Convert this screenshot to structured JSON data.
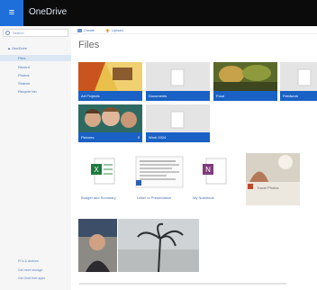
{
  "app": {
    "title": "OneDrive",
    "waffle_glyph": "≡"
  },
  "colors": {
    "accent": "#1961c4",
    "topbar": "#0b0b0b",
    "waffle": "#1e6fd9",
    "sidebar": "#f6f6f6"
  },
  "search": {
    "placeholder": "Search"
  },
  "sidebar": {
    "items": [
      {
        "label": "▲ OneDrive"
      },
      {
        "label": "Files"
      },
      {
        "label": "Recent"
      },
      {
        "label": "Photos"
      },
      {
        "label": "Shared"
      },
      {
        "label": "Recycle bin"
      }
    ],
    "footer": [
      {
        "label": "PCs & devices"
      },
      {
        "label": "Get more storage"
      },
      {
        "label": "Get OneDrive apps"
      }
    ]
  },
  "commands": [
    {
      "label": "Create",
      "icon": "plus-icon"
    },
    {
      "label": "Upload",
      "icon": "upload-icon"
    }
  ],
  "page_title": "Files",
  "folders": [
    {
      "name": "Art Projects",
      "count": ""
    },
    {
      "name": "Documents",
      "count": ""
    },
    {
      "name": "Food",
      "count": ""
    },
    {
      "name": "Fieldwork",
      "count": ""
    },
    {
      "name": "Pictures",
      "count": "9"
    },
    {
      "name": "Work 2024",
      "count": ""
    }
  ],
  "files": [
    {
      "name": "Budget and Summary",
      "type": "excel"
    },
    {
      "name": "Letter to Presentation",
      "type": "document"
    },
    {
      "name": "My Notebook",
      "type": "onenote"
    },
    {
      "name": "Travel Photos",
      "type": "powerpoint"
    }
  ]
}
